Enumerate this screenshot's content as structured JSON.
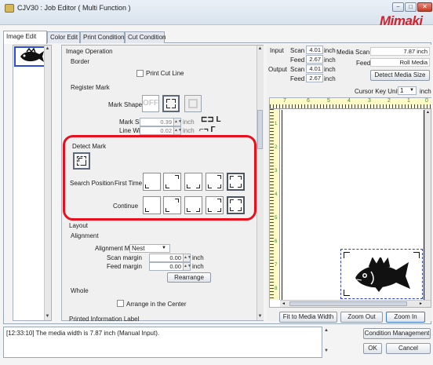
{
  "window": {
    "title": "CJV30 : Job Editor ( Multi Function )",
    "min": "−",
    "max": "□",
    "close": "✕",
    "logo": "Mimaki"
  },
  "tabs": [
    "Image Edit",
    "Color Edit",
    "Print Condition",
    "Cut Condition"
  ],
  "image_operation": {
    "heading": "Image Operation",
    "border": "Border",
    "print_cut_line": "Print Cut Line",
    "register_mark": "Register Mark",
    "mark_shape_label": "Mark Shape",
    "mark_shape_off": "OFF",
    "mark_size_label": "Mark Size",
    "mark_size_value": "0.39",
    "line_width_label": "Line Width",
    "line_width_value": "0.02",
    "unit": "inch",
    "detect_mark": "Detect Mark",
    "search_position_label": "Search Position",
    "first_time_label": "First Time",
    "continue_label": "Continue",
    "layout": "Layout",
    "alignment": "Alignment",
    "alignment_mode_label": "Alignment Mode",
    "alignment_mode_value": "Nest",
    "scan_margin_label": "Scan margin",
    "scan_margin_value": "0.00",
    "feed_margin_label": "Feed margin",
    "feed_margin_value": "0.00",
    "rearrange": "Rearrange",
    "whole": "Whole",
    "arrange_center": "Arrange in the Center",
    "printed_info": "Printed Information Label"
  },
  "right": {
    "input_label": "Input",
    "scan_label": "Scan",
    "feed_label": "Feed",
    "input_scan": "4.01",
    "input_feed": "2.67",
    "output_label": "Output",
    "output_scan": "4.01",
    "output_feed": "2.67",
    "unit": "inch",
    "media_scan_label": "Media Scan",
    "media_scan_value": "7.87 inch",
    "media_feed_label": "Feed",
    "media_feed_value": "Roll Media",
    "detect_media_size": "Detect Media Size",
    "cursor_key_label": "Cursor Key Unit",
    "cursor_key_value": "1",
    "cursor_key_unit": "inch",
    "ruler_ticks": [
      "7",
      "6",
      "5",
      "4",
      "3",
      "2",
      "1",
      "0"
    ],
    "vruler_ticks": [
      "1",
      "2",
      "3",
      "4",
      "5",
      "6",
      "7",
      "8"
    ],
    "fit_width": "Fit to Media Width",
    "zoom_out": "Zoom Out",
    "zoom_in": "Zoom In"
  },
  "status": {
    "log": "[12:33:10] The media width is 7.87 inch (Manual Input).",
    "condition_management": "Condition Management",
    "ok": "OK",
    "cancel": "Cancel"
  }
}
